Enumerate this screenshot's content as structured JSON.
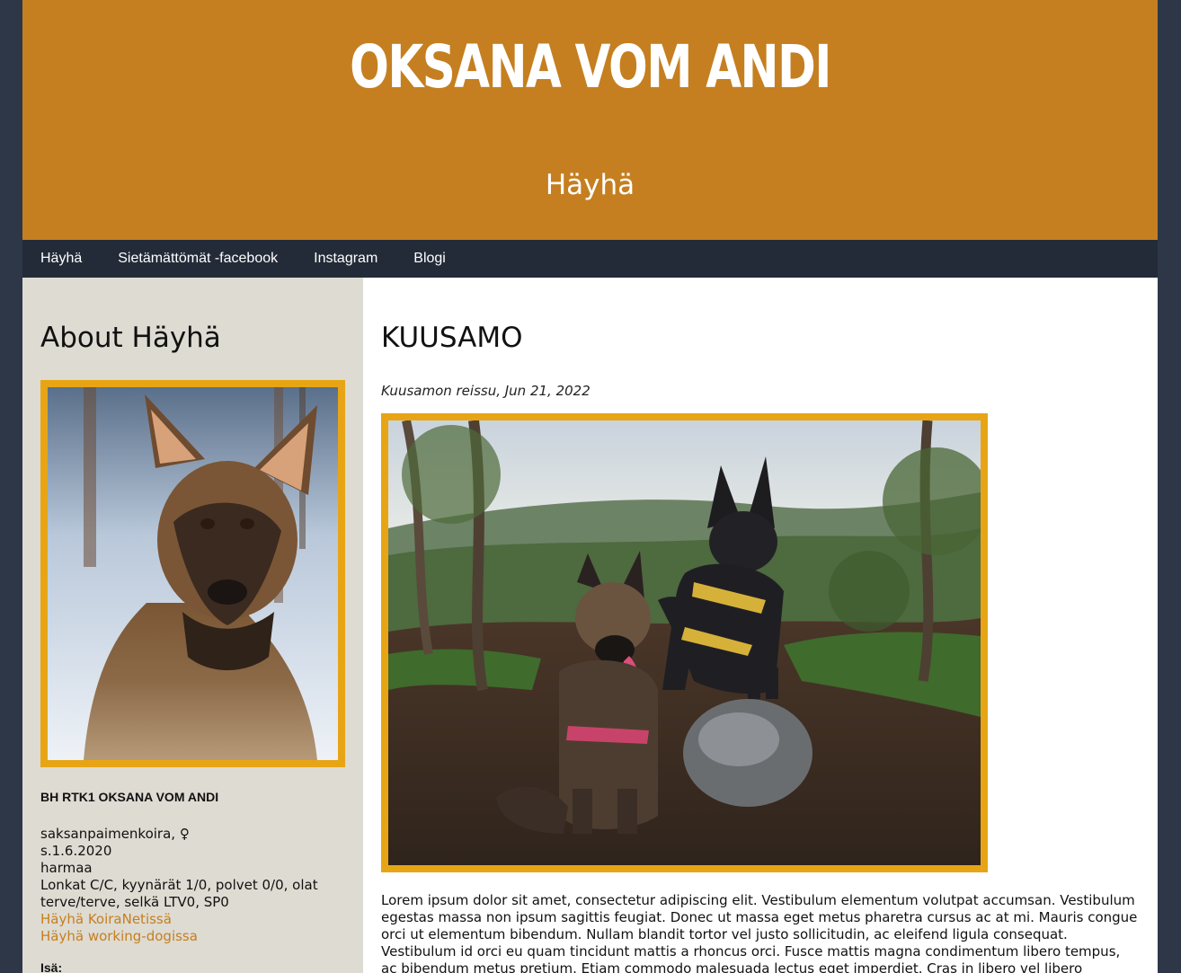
{
  "header": {
    "title": "OKSANA VOM ANDI",
    "subtitle": "Häyhä"
  },
  "nav": {
    "items": [
      {
        "label": "Häyhä"
      },
      {
        "label": "Sietämättömät -facebook"
      },
      {
        "label": "Instagram"
      },
      {
        "label": "Blogi"
      }
    ]
  },
  "sidebar": {
    "title": "About Häyhä",
    "dog_name": "BH RTK1 OKSANA VOM ANDI",
    "info": [
      "saksanpaimenkoira, ♀",
      "s.1.6.2020",
      "harmaa",
      "Lonkat C/C, kyynärät 1/0, polvet 0/0, olat terve/terve, selkä LTV0, SP0"
    ],
    "links": [
      {
        "label": "Häyhä KoiraNetissä"
      },
      {
        "label": "Häyhä working-dogissa"
      }
    ],
    "isa_label": "Isä:"
  },
  "post": {
    "title": "KUUSAMO",
    "meta": "Kuusamon reissu, Jun 21, 2022",
    "body": "Lorem ipsum dolor sit amet, consectetur adipiscing elit. Vestibulum elementum volutpat accumsan. Vestibulum egestas massa non ipsum sagittis feugiat. Donec ut massa eget metus pharetra cursus ac at mi. Mauris congue orci ut elementum bibendum. Nullam blandit tortor vel justo sollicitudin, ac eleifend ligula consequat. Vestibulum id orci eu quam tincidunt mattis a rhoncus orci. Fusce mattis magna condimentum libero tempus, ac bibendum metus pretium. Etiam commodo malesuada lectus eget imperdiet. Cras in libero vel libero scelerisque elementum et a elit. Quisque feugiat fringilla turpis,"
  },
  "colors": {
    "accent": "#c57f20",
    "frame": "#e7a516",
    "nav_bg": "#232b39",
    "sidebar_bg": "#dedbd2",
    "outer_bg": "#2d3748"
  }
}
